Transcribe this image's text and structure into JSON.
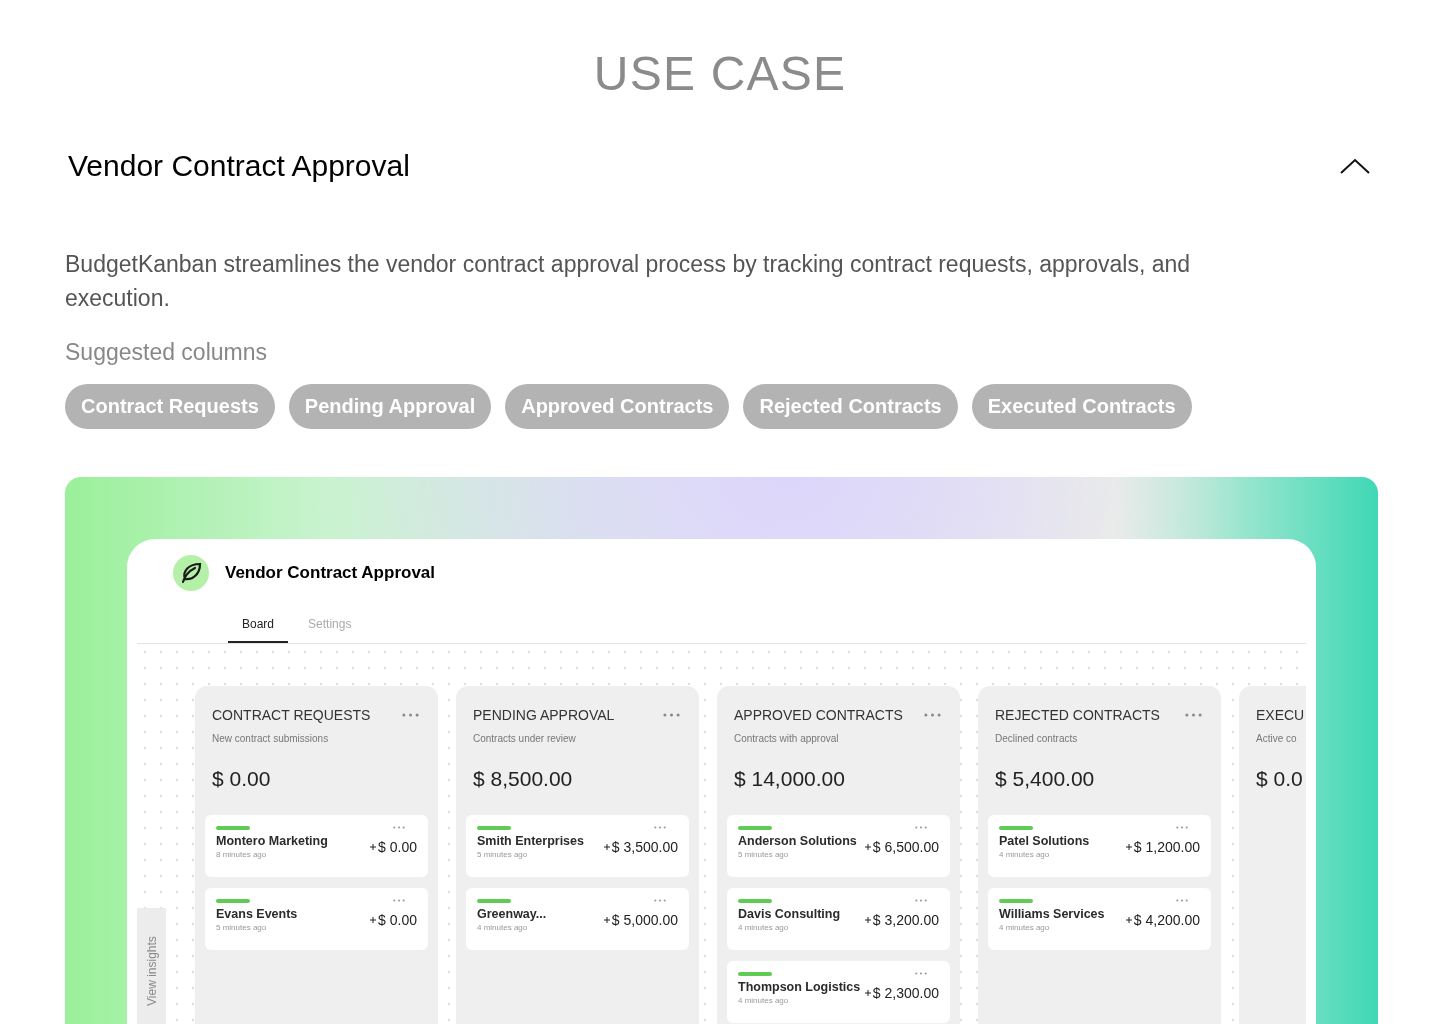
{
  "section_title": "USE CASE",
  "accordion": {
    "title": "Vendor Contract Approval",
    "expanded": true,
    "description": "BudgetKanban streamlines the vendor contract approval process by tracking contract requests, approvals, and execution.",
    "suggested_label": "Suggested columns",
    "chips": [
      "Contract Requests",
      "Pending Approval",
      "Approved Contracts",
      "Rejected Contracts",
      "Executed Contracts"
    ]
  },
  "app": {
    "title": "Vendor Contract Approval",
    "tabs": [
      {
        "label": "Board",
        "selected": true
      },
      {
        "label": "Settings",
        "selected": false
      }
    ],
    "side_tab": "View insights",
    "columns": [
      {
        "title": "CONTRACT REQUESTS",
        "subtitle": "New contract submissions",
        "total": "$ 0.00",
        "cards": [
          {
            "name": "Montero Marketing",
            "time": "8 minutes ago",
            "amount": "$ 0.00"
          },
          {
            "name": "Evans Events",
            "time": "5 minutes ago",
            "amount": "$ 0.00"
          }
        ]
      },
      {
        "title": "PENDING APPROVAL",
        "subtitle": "Contracts under review",
        "total": "$ 8,500.00",
        "cards": [
          {
            "name": "Smith Enterprises",
            "time": "5 minutes ago",
            "amount": "$ 3,500.00"
          },
          {
            "name": "Greenway...",
            "time": "4 minutes ago",
            "amount": "$ 5,000.00"
          }
        ]
      },
      {
        "title": "APPROVED CONTRACTS",
        "subtitle": "Contracts with approval",
        "total": "$ 14,000.00",
        "cards": [
          {
            "name": "Anderson Solutions",
            "time": "5 minutes ago",
            "amount": "$ 6,500.00"
          },
          {
            "name": "Davis Consulting",
            "time": "4 minutes ago",
            "amount": "$ 3,200.00"
          },
          {
            "name": "Thompson Logistics",
            "time": "4 minutes ago",
            "amount": "$ 2,300.00"
          }
        ]
      },
      {
        "title": "REJECTED CONTRACTS",
        "subtitle": "Declined contracts",
        "total": "$ 5,400.00",
        "cards": [
          {
            "name": "Patel Solutions",
            "time": "4 minutes ago",
            "amount": "$ 1,200.00"
          },
          {
            "name": "Williams Services",
            "time": "4 minutes ago",
            "amount": "$ 4,200.00"
          }
        ]
      },
      {
        "title": "EXECU",
        "subtitle": "Active co",
        "total": "$ 0.0"
      }
    ]
  }
}
